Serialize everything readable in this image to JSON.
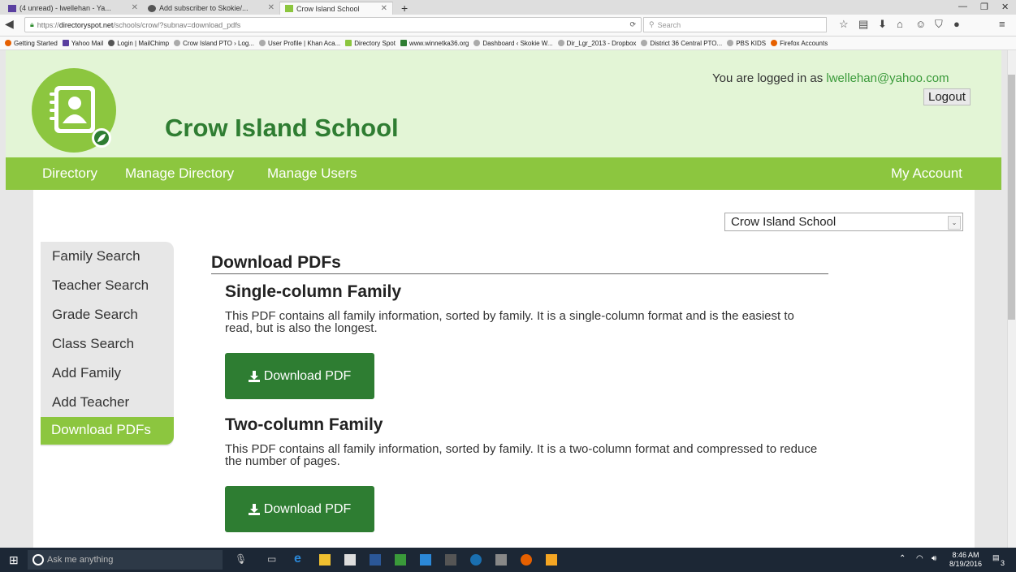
{
  "browser": {
    "tabs": [
      {
        "label": "(4 unread) - lwellehan - Ya..."
      },
      {
        "label": "Add subscriber to Skokie/..."
      },
      {
        "label": "Crow Island School"
      }
    ],
    "url_prefix": "https://",
    "url_domain": "directoryspot.net",
    "url_path": "/schools/crow/?subnav=download_pdfs",
    "search_placeholder": "Search",
    "bookmarks": [
      "Getting Started",
      "Yahoo Mail",
      "Login | MailChimp",
      "Crow Island PTO › Log...",
      "User Profile | Khan Aca...",
      "Directory Spot",
      "www.winnetka36.org",
      "Dashboard ‹ Skokie W...",
      "Dir_Lgr_2013 - Dropbox",
      "District 36 Central PTO...",
      "PBS KIDS",
      "Firefox Accounts"
    ]
  },
  "header": {
    "school_name": "Crow Island School",
    "login_prefix": "You are logged in as ",
    "login_email": "lwellehan@yahoo.com",
    "logout_label": "Logout"
  },
  "menu": {
    "directory": "Directory",
    "manage_directory": "Manage Directory",
    "manage_users": "Manage Users",
    "my_account": "My Account"
  },
  "school_select": {
    "selected": "Crow Island School"
  },
  "sidenav": {
    "items": [
      "Family Search",
      "Teacher Search",
      "Grade Search",
      "Class Search",
      "Add Family",
      "Add Teacher"
    ],
    "active": "Download PDFs"
  },
  "main": {
    "title": "Download PDFs",
    "sections": [
      {
        "title": "Single-column Family",
        "desc": "This PDF contains all family information, sorted by family. It is a single-column format and is the easiest to read, but is also the longest.",
        "button": "Download PDF"
      },
      {
        "title": "Two-column Family",
        "desc": "This PDF contains all family information, sorted by family. It is a two-column format and compressed to reduce the number of pages.",
        "button": "Download PDF"
      }
    ]
  },
  "taskbar": {
    "search_placeholder": "Ask me anything",
    "time": "8:46 AM",
    "date": "8/19/2016",
    "notifications": "3"
  },
  "colors": {
    "green": "#8cc63f",
    "dark_green": "#2e7d32",
    "header_bg": "#e3f5d6"
  }
}
